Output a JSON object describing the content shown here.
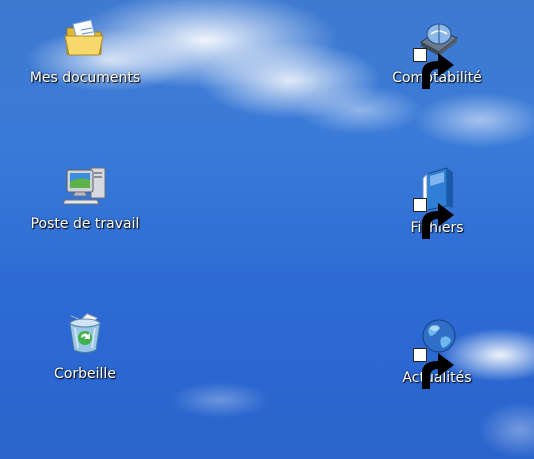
{
  "desktop": {
    "icons": [
      {
        "label": "Mes documents",
        "icon": "my-documents-folder-icon"
      },
      {
        "label": "Comptabilité",
        "icon": "accounting-drive-shortcut-icon"
      },
      {
        "label": "Poste de travail",
        "icon": "my-computer-icon"
      },
      {
        "label": "Fichiers",
        "icon": "files-folder-shortcut-icon"
      },
      {
        "label": "Corbeille",
        "icon": "recycle-bin-icon"
      },
      {
        "label": "Actualités",
        "icon": "globe-news-shortcut-icon"
      }
    ]
  },
  "colors": {
    "sky": "#3a7bd8",
    "label_text": "#ffffff"
  }
}
